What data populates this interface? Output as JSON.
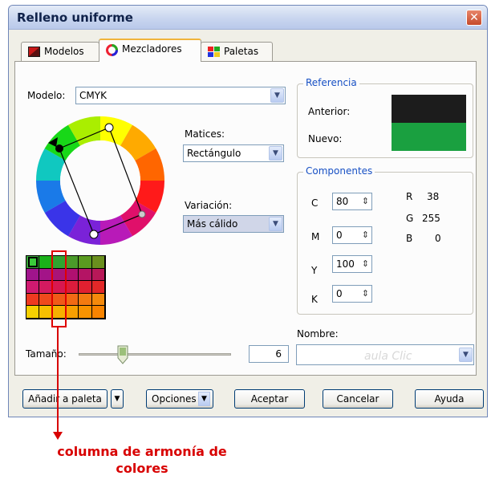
{
  "window": {
    "title": "Relleno uniforme",
    "close_glyph": "✕"
  },
  "tabs": [
    {
      "label": "Modelos",
      "icon": "model-icon",
      "active": false
    },
    {
      "label": "Mezcladores",
      "icon": "mixer-icon",
      "active": true
    },
    {
      "label": "Paletas",
      "icon": "palette-icon",
      "active": false
    }
  ],
  "model": {
    "label": "Modelo:",
    "value": "CMYK"
  },
  "hues": {
    "label": "Matices:",
    "value": "Rectángulo"
  },
  "variation": {
    "label": "Variación:",
    "value": "Más cálido"
  },
  "reference": {
    "title": "Referencia",
    "previous_label": "Anterior:",
    "new_label": "Nuevo:",
    "previous_color": "#1c1c1c",
    "new_color": "#1aa040"
  },
  "components": {
    "title": "Componentes",
    "fields": [
      {
        "label": "C",
        "value": "80"
      },
      {
        "label": "M",
        "value": "0"
      },
      {
        "label": "Y",
        "value": "100"
      },
      {
        "label": "K",
        "value": "0"
      }
    ],
    "rgb": [
      {
        "label": "R",
        "value": "38"
      },
      {
        "label": "G",
        "value": "255"
      },
      {
        "label": "B",
        "value": "0"
      }
    ]
  },
  "name": {
    "label": "Nombre:",
    "value": ""
  },
  "size": {
    "label": "Tamaño:",
    "value": "6"
  },
  "buttons": {
    "add_palette": "Añadir a paleta",
    "options": "Opciones",
    "accept": "Aceptar",
    "cancel": "Cancelar",
    "help": "Ayuda"
  },
  "watermark": "aula Clic",
  "palette_grid": [
    [
      "#3aa83a",
      "#1ab01a",
      "#2fa52f",
      "#4a9a2a",
      "#5a9a20",
      "#6a8f1e"
    ],
    [
      "#a0148c",
      "#a31488",
      "#a91378",
      "#b01070",
      "#b41464",
      "#b81858"
    ],
    [
      "#d01a70",
      "#d41a60",
      "#d81850",
      "#dc1c3c",
      "#e02030",
      "#e22828"
    ],
    [
      "#ee3a20",
      "#ef4a1c",
      "#f05a18",
      "#f26a14",
      "#f37a10",
      "#f48a0c"
    ],
    [
      "#f6d000",
      "#f6c000",
      "#f7b000",
      "#f8a000",
      "#f89200",
      "#f98400"
    ]
  ],
  "annotation": "columna de armonía de colores",
  "colors": {
    "accent_blue": "#1750c4",
    "annotation_red": "#d80000",
    "tab_highlight": "#f0b43a"
  }
}
